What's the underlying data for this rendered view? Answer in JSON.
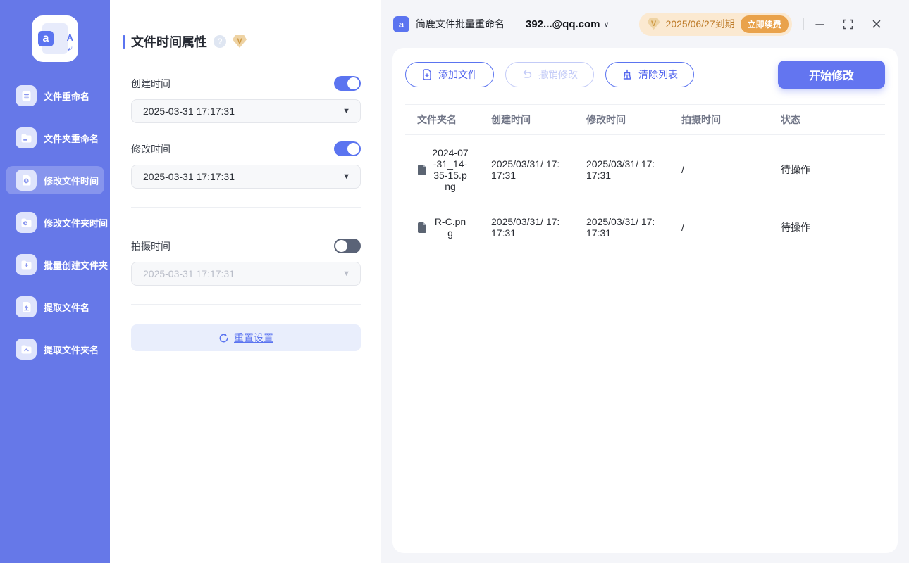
{
  "sidebar": {
    "items": [
      {
        "label": "文件重命名",
        "icon": "file-rename-icon"
      },
      {
        "label": "文件夹重命名",
        "icon": "folder-rename-icon"
      },
      {
        "label": "修改文件时间",
        "icon": "file-time-icon",
        "active": true
      },
      {
        "label": "修改文件夹时间",
        "icon": "folder-time-icon"
      },
      {
        "label": "批量创建文件夹",
        "icon": "folder-plus-icon"
      },
      {
        "label": "提取文件名",
        "icon": "file-extract-icon"
      },
      {
        "label": "提取文件夹名",
        "icon": "folder-extract-icon"
      }
    ]
  },
  "settings_panel": {
    "title": "文件时间属性",
    "help_glyph": "?",
    "vip_glyph": "V",
    "fields": [
      {
        "label": "创建时间",
        "value": "2025-03-31 17:17:31",
        "enabled": true
      },
      {
        "label": "修改时间",
        "value": "2025-03-31 17:17:31",
        "enabled": true
      },
      {
        "label": "拍摄时间",
        "value": "2025-03-31 17:17:31",
        "enabled": false
      }
    ],
    "dropdown_caret": "▼",
    "reset_label": "重置设置"
  },
  "titlebar": {
    "app_icon_glyph": "a",
    "app_title": "简鹿文件批量重命名",
    "account": "392...@qq.com",
    "account_caret": "∨",
    "license_expiry": "2025/06/27到期",
    "renew_label": "立即续费"
  },
  "toolbar": {
    "add_files": "添加文件",
    "undo": "撤销修改",
    "clear": "清除列表",
    "start": "开始修改"
  },
  "table": {
    "headers": [
      "文件夹名",
      "创建时间",
      "修改时间",
      "拍摄时间",
      "状态"
    ],
    "rows": [
      {
        "name": "2024-07-31_14-35-15.png",
        "created": "2025/03/31/ 17:17:31",
        "modified": "2025/03/31/ 17:17:31",
        "captured": "/",
        "status": "待操作"
      },
      {
        "name": "R-C.png",
        "created": "2025/03/31/ 17:17:31",
        "modified": "2025/03/31/ 17:17:31",
        "captured": "/",
        "status": "待操作"
      }
    ]
  },
  "colors": {
    "sidebar_bg": "#6678e8",
    "accent_blue": "#5b74f0",
    "primary_button": "#6375f0",
    "toggle_off": "#5a6377",
    "license_badge_bg": "#fbe9d1",
    "license_text": "#bf7d2c",
    "renew_button_bg": "#e9a24b",
    "panel_bg": "#f4f5f9"
  }
}
